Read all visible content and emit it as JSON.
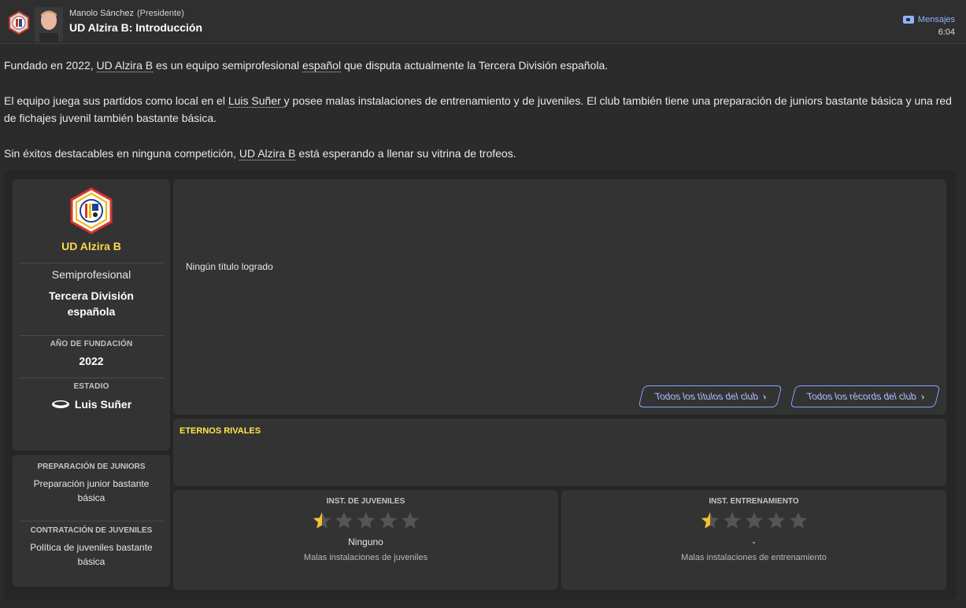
{
  "header": {
    "manager_name": "Manolo Sánchez",
    "manager_role": "(Presidente)",
    "title": "UD Alzira B: Introducción",
    "messages_label": "Mensajes",
    "time": "6:04"
  },
  "intro": {
    "p1_a": "Fundado en 2022, ",
    "p1_club": "UD Alzira B",
    "p1_b": " es un equipo semiprofesional ",
    "p1_nation": "español",
    "p1_c": " que disputa actualmente la Tercera División española.",
    "p2_a": "El equipo juega sus partidos como local en el ",
    "p2_stadium": "Luis Suñer ",
    "p2_b": "y posee malas instalaciones de entrenamiento y de juveniles. El club también tiene una preparación de juniors bastante básica y una red de fichajes juvenil también bastante básica.",
    "p3_a": "Sin éxitos destacables en ninguna competición, ",
    "p3_club": "UD Alzira B",
    "p3_b": " está esperando a llenar su vitrina de trofeos."
  },
  "club_card": {
    "name": "UD Alzira B",
    "status": "Semiprofesional",
    "league": "Tercera División española",
    "founded_label": "AÑO DE FUNDACIÓN",
    "founded_value": "2022",
    "stadium_label": "ESTADIO",
    "stadium_value": "Luis Suñer"
  },
  "youth_card": {
    "junior_label": "PREPARACIÓN DE JUNIORS",
    "junior_value": "Preparación junior bastante básica",
    "recruit_label": "CONTRATACIÓN DE JUVENILES",
    "recruit_value": "Política de juveniles bastante básica"
  },
  "trophies": {
    "empty_text": "Ningún título logrado",
    "all_titles_button": "Todos los títulos del club",
    "all_records_button": "Todos los récords del club"
  },
  "rivals": {
    "heading": "ETERNOS RIVALES"
  },
  "facilities": [
    {
      "heading": "INST. DE JUVENILES",
      "rating": 0.5,
      "max": 5,
      "value": "Ninguno",
      "desc": "Malas instalaciones de juveniles"
    },
    {
      "heading": "INST. ENTRENAMIENTO",
      "rating": 0.5,
      "max": 5,
      "value": "-",
      "desc": "Malas instalaciones de entrenamiento"
    }
  ],
  "colors": {
    "accent_link": "#8fb3ff",
    "club_name": "#ffd84a",
    "rivals_heading": "#ffe84a",
    "star_fill": "#f2c230",
    "star_empty": "#555555"
  },
  "icons": {
    "crest": "club-crest-icon",
    "messages": "messages-icon",
    "stadium": "stadium-icon",
    "chevron": "chevron-right-icon"
  }
}
